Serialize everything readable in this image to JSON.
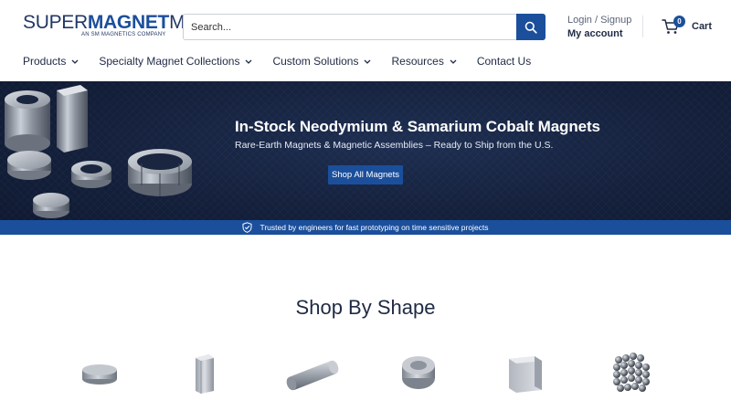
{
  "brand": {
    "logo_word_1": "SUPER",
    "logo_word_2": "MAGNET",
    "logo_word_3": "MAN",
    "tagline": "AN SM MAGNETICS COMPANY",
    "primary_color": "#1b4f9c",
    "navy_color": "#233766"
  },
  "search": {
    "placeholder": "Search..."
  },
  "account": {
    "login_label": "Login / Signup",
    "account_label": "My account"
  },
  "cart": {
    "count": "0",
    "label": "Cart"
  },
  "nav": {
    "items": [
      {
        "label": "Products",
        "has_dropdown": true
      },
      {
        "label": "Specialty Magnet Collections",
        "has_dropdown": true
      },
      {
        "label": "Custom Solutions",
        "has_dropdown": true
      },
      {
        "label": "Resources",
        "has_dropdown": true
      },
      {
        "label": "Contact Us",
        "has_dropdown": false
      }
    ]
  },
  "hero": {
    "title": "In-Stock Neodymium & Samarium Cobalt Magnets",
    "subtitle": "Rare-Earth Magnets & Magnetic Assemblies  – Ready to Ship from the U.S.",
    "cta_label": "Shop All Magnets",
    "trust_text": "Trusted by engineers for fast prototyping on time sensitive projects",
    "trust_icon": "shield-check-icon"
  },
  "shop_by_shape": {
    "title": "Shop By Shape",
    "shapes": [
      {
        "icon": "disc-magnet-icon"
      },
      {
        "icon": "block-magnet-icon"
      },
      {
        "icon": "cylinder-magnet-icon"
      },
      {
        "icon": "ring-magnet-icon"
      },
      {
        "icon": "cube-magnet-icon"
      },
      {
        "icon": "sphere-magnet-icon"
      }
    ]
  }
}
